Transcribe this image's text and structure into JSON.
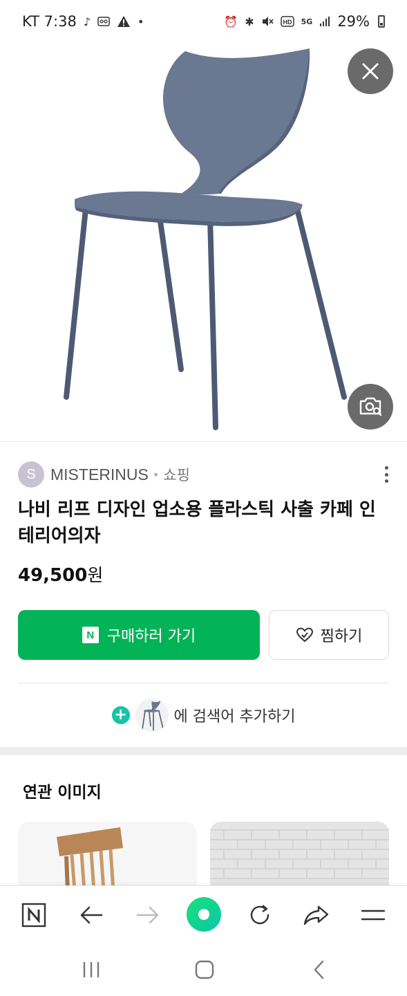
{
  "status_bar": {
    "carrier_time": "KT 7:38",
    "battery": "29%",
    "icons": [
      "tiktok-icon",
      "voicemail-icon",
      "warning-icon",
      "dot-icon",
      "alarm-icon",
      "bluetooth-icon",
      "mute-icon",
      "hd-icon",
      "5g-icon",
      "signal-icon",
      "battery-icon"
    ]
  },
  "product_image": {
    "subject": "chair",
    "chair_color": "#5f6d86",
    "leg_color": "#4d5a73"
  },
  "overlay_buttons": {
    "close_icon": "close-icon",
    "lens_icon": "image-search-icon"
  },
  "seller": {
    "avatar_letter": "S",
    "name": "MISTERINUS",
    "separator": "•",
    "category": "쇼핑"
  },
  "product": {
    "title": "나비 리프 디자인 업소용 플라스틱 사출 카페 인테리어의자",
    "price_number": "49,500",
    "price_unit": "원"
  },
  "actions": {
    "buy_badge": "N",
    "buy_label": "구매하러 가기",
    "wish_label": "찜하기",
    "add_search_label": "에 검색어 추가하기"
  },
  "related": {
    "title": "연관 이미지"
  },
  "toolbar": {
    "home_badge": "N",
    "icons": [
      "naver-home-icon",
      "back-arrow-icon",
      "forward-arrow-icon",
      "green-dot-icon",
      "refresh-icon",
      "share-icon",
      "menu-icon"
    ]
  },
  "colors": {
    "accent_green": "#03b358",
    "plus_teal": "#13c5a6",
    "overlay_gray": "#5a5a5a"
  }
}
